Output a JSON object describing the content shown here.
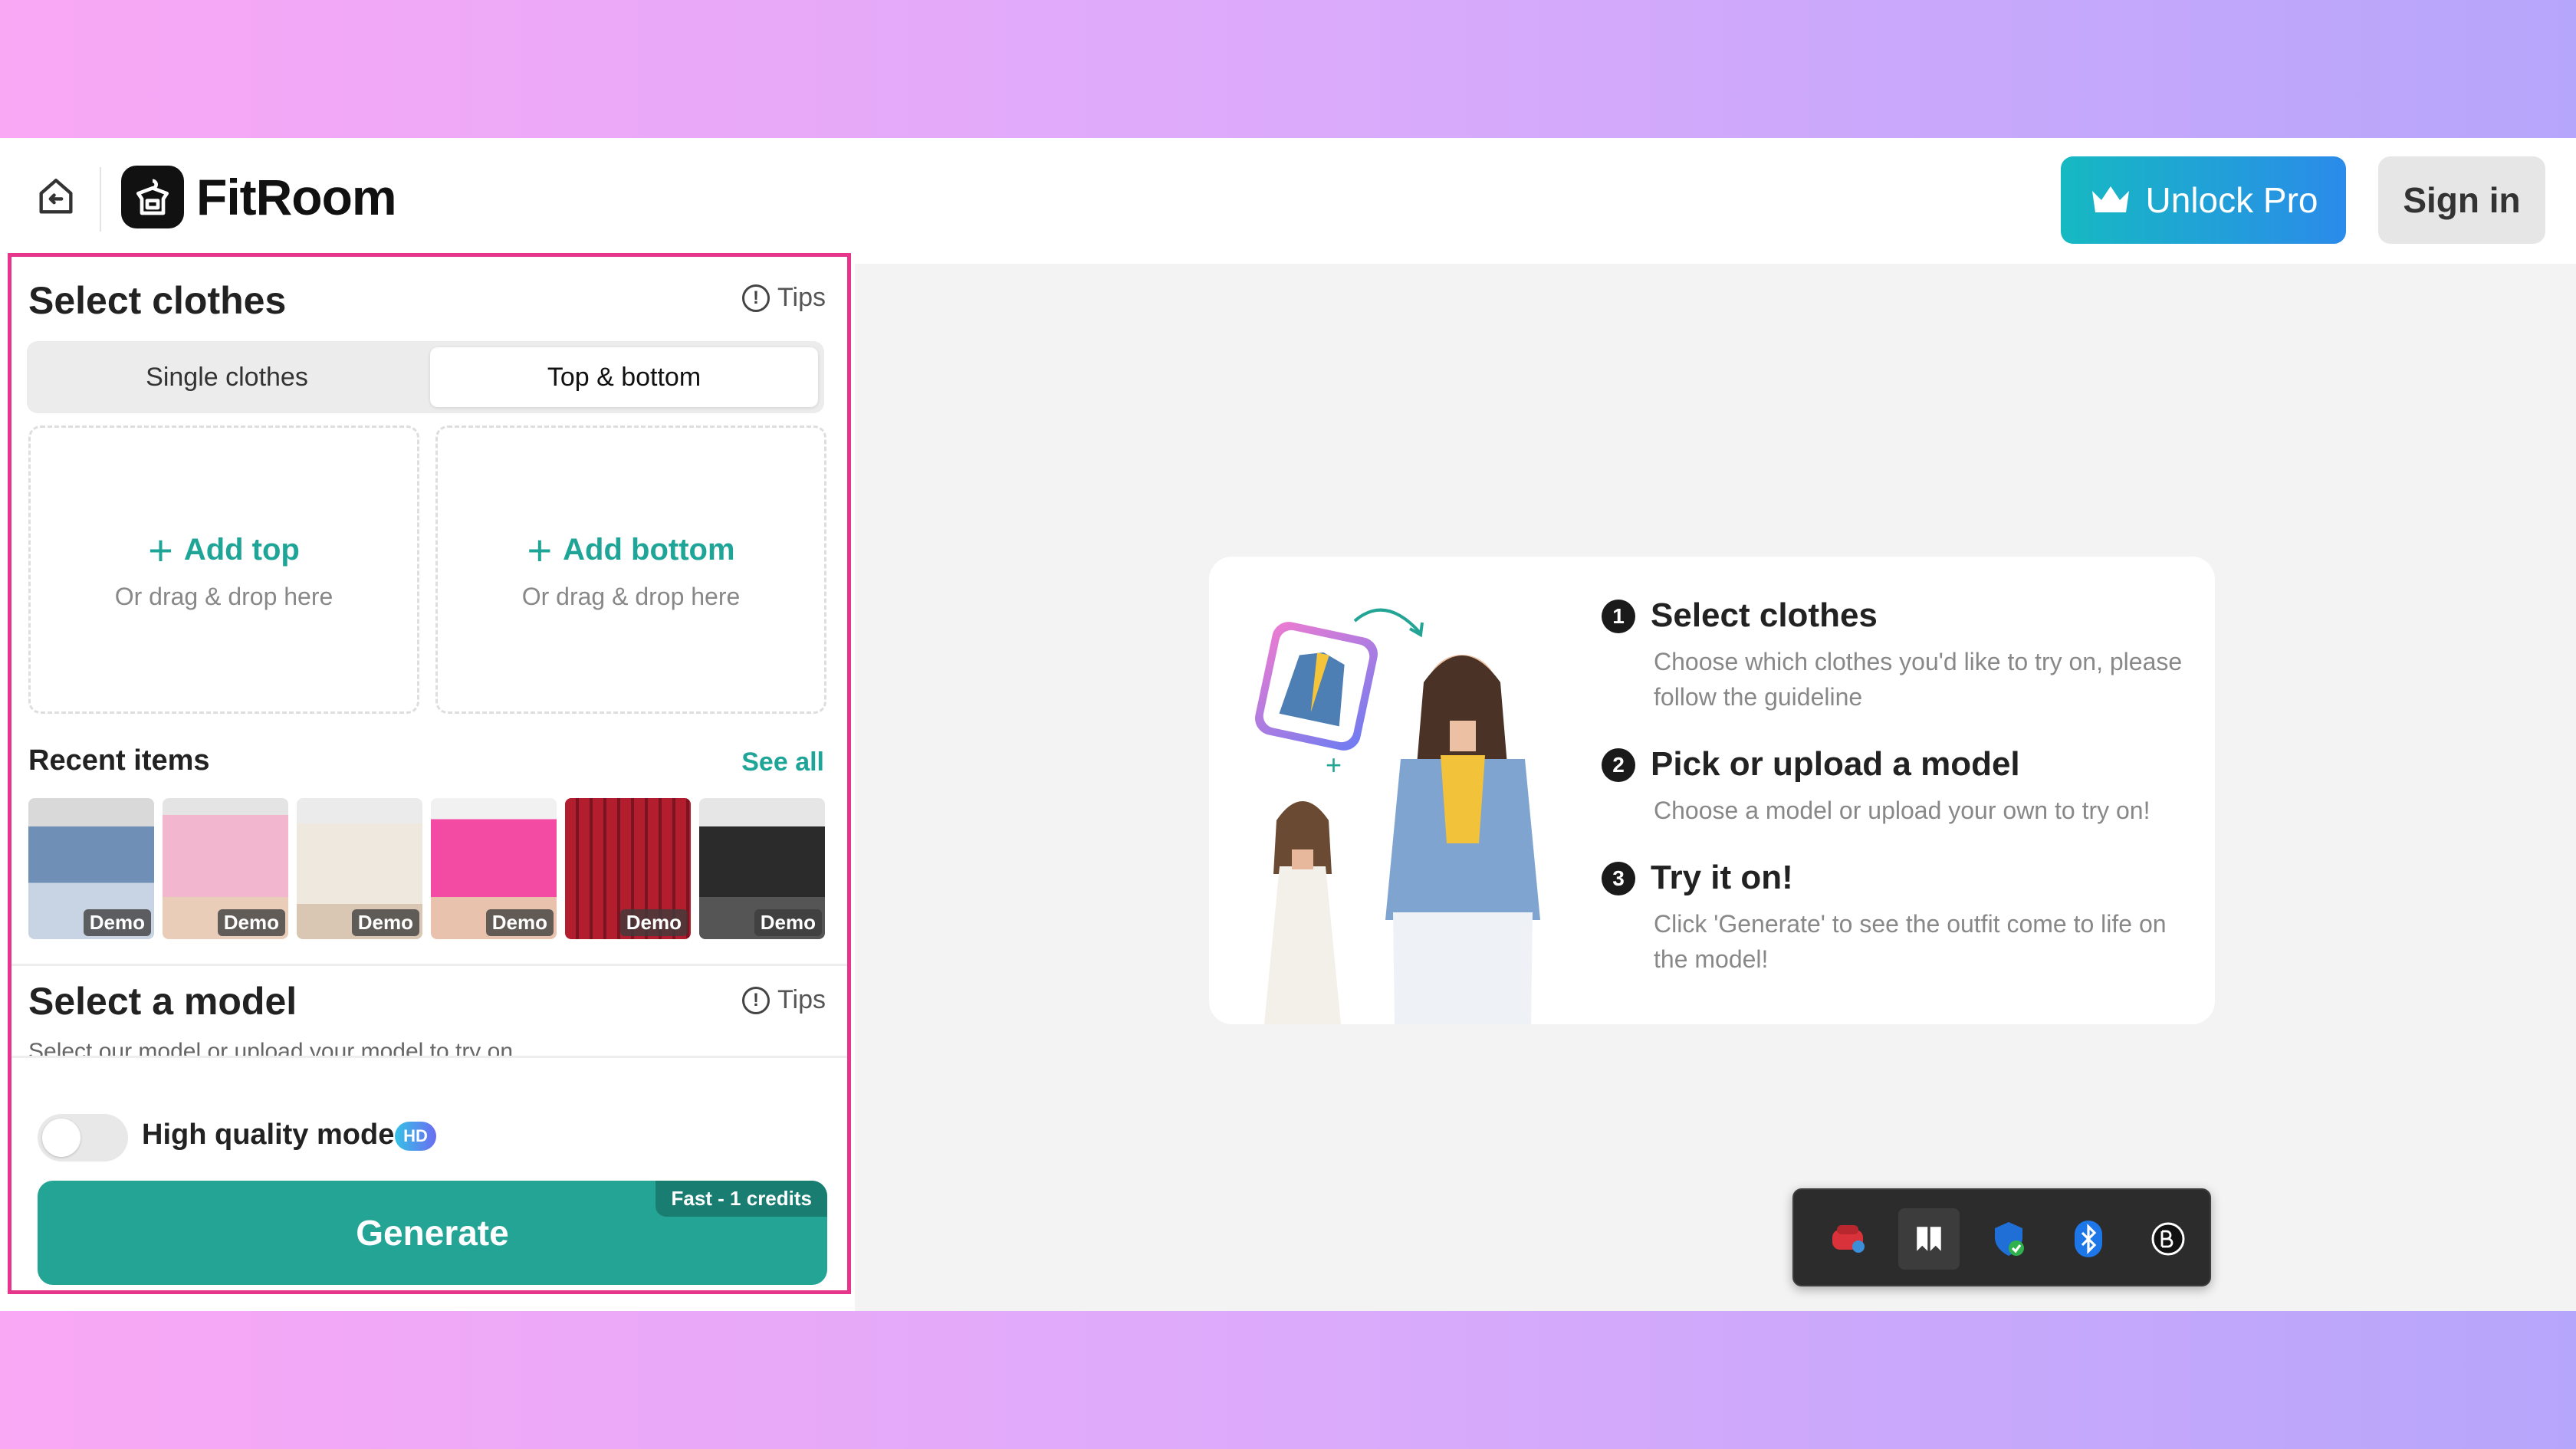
{
  "header": {
    "app_name": "FitRoom",
    "unlock_label": "Unlock Pro",
    "signin_label": "Sign in"
  },
  "clothes": {
    "title": "Select clothes",
    "tips_label": "Tips",
    "tabs": [
      {
        "label": "Single clothes",
        "active": false
      },
      {
        "label": "Top & bottom",
        "active": true
      }
    ],
    "add_top": "Add top",
    "add_bottom": "Add bottom",
    "drop_hint": "Or drag & drop here",
    "recent_title": "Recent items",
    "see_all": "See all",
    "demo_label": "Demo",
    "recent_items": [
      {
        "name": "corset-top",
        "color": "#6f8fb6"
      },
      {
        "name": "pink-skirt",
        "color": "#f2b6cf"
      },
      {
        "name": "white-cardigan",
        "color": "#efe8df"
      },
      {
        "name": "pink-mini-skirt",
        "color": "#f34aa3"
      },
      {
        "name": "red-plaid-skirt",
        "color": "#b31e2e"
      },
      {
        "name": "black-shirt",
        "color": "#2b2b2b"
      }
    ]
  },
  "model": {
    "title": "Select a model",
    "tips_label": "Tips",
    "subtitle": "Select our model or upload your model to try on"
  },
  "options": {
    "hq_label": "High quality mode",
    "hq_enabled": false,
    "hd_badge": "HD",
    "generate_label": "Generate",
    "generate_tag": "Fast - 1 credits"
  },
  "guide": {
    "steps": [
      {
        "num": "1",
        "title": "Select clothes",
        "desc": "Choose which clothes you'd like to try on, please follow the guideline"
      },
      {
        "num": "2",
        "title": "Pick or upload a model",
        "desc": "Choose a model or upload your own to try on!"
      },
      {
        "num": "3",
        "title": "Try it on!",
        "desc": "Click 'Generate' to see the outfit come to life on the model!"
      }
    ]
  },
  "tray": {
    "icons": [
      "red-sync-icon",
      "bookmark-app-icon",
      "shield-icon",
      "bluetooth-icon",
      "app-circle-icon"
    ]
  },
  "colors": {
    "accent": "#23a495",
    "highlight_border": "#e6358a",
    "pro_gradient_start": "#16b9c2",
    "pro_gradient_end": "#2b8bea"
  }
}
